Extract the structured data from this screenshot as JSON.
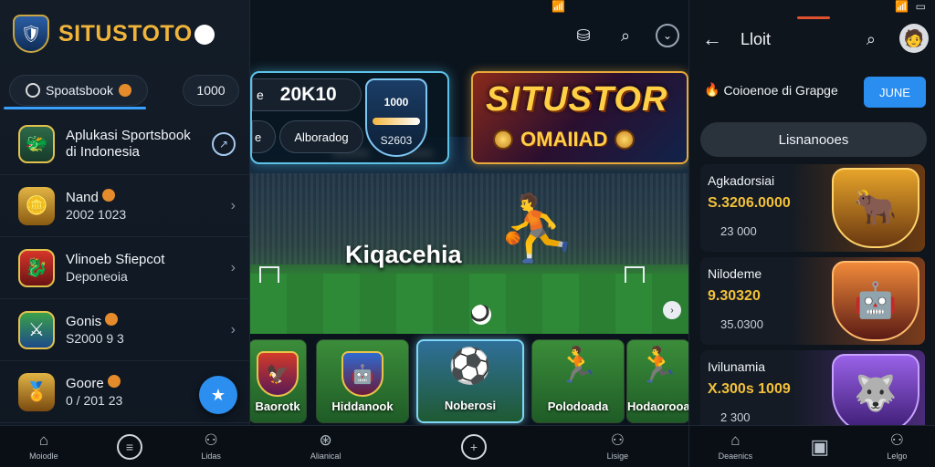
{
  "left": {
    "brand": "SITUSTOTO",
    "tabs": {
      "sportsbook": "Spoatsbook",
      "number": "1000"
    },
    "items": [
      {
        "title": "Aplukasi Sportsbook",
        "sub": "di Indonesia",
        "thumb_icon": "mascot-icon"
      },
      {
        "title": "Nand",
        "sub": "2002 1023",
        "thumb_icon": "coin-stack-icon"
      },
      {
        "title": "Vlinoeb Sfiepcot",
        "sub": "Deponeoia",
        "thumb_icon": "dragon-shield-icon"
      },
      {
        "title": "Gonis",
        "sub": "S2000 9 3",
        "thumb_icon": "green-shield-icon"
      },
      {
        "title": "Goore",
        "sub": "0 / 201 23",
        "thumb_icon": "gold-emblem-icon"
      }
    ],
    "nav": [
      {
        "label": "Moiodle",
        "icon": "home-icon"
      },
      {
        "label": "",
        "icon": "chat-icon"
      },
      {
        "label": "Lidas",
        "icon": "user-icon"
      }
    ]
  },
  "mid": {
    "score": {
      "prefix": "e",
      "value": "20K10",
      "team_short": "e",
      "label2": "Alboradog",
      "shield_top": "1000",
      "shield_bottom": "S2603"
    },
    "promo": {
      "title": "SITUSTOR",
      "sub": "OMAIIAD"
    },
    "hero_title": "Kiqacehia",
    "games": [
      {
        "name": "Baorotk"
      },
      {
        "name": "Hiddanook"
      },
      {
        "name": "Noberosi"
      },
      {
        "name": "Polodoada"
      },
      {
        "name": "Hodaorooa"
      }
    ],
    "nav": [
      {
        "label": "Alianical",
        "icon": "soccer-icon"
      },
      {
        "label": "",
        "icon": "plus-icon"
      },
      {
        "label": "Lisige",
        "icon": "user-icon"
      }
    ]
  },
  "right": {
    "title": "Lloit",
    "coin_text": "Coioenoe di  Grapge",
    "june_button": "JUNE",
    "search_label": "Lisnanooes",
    "cards": [
      {
        "name": "Agkadorsiai",
        "amount": "S.3206.0000",
        "minor": "23 000"
      },
      {
        "name": "Nilodeme",
        "amount": "9.30320",
        "minor": "35.0300"
      },
      {
        "name": "Ivilunamia",
        "amount": "X.300s 1009",
        "minor": "2 300"
      }
    ],
    "nav": [
      {
        "label": "Deaenics",
        "icon": "home-icon"
      },
      {
        "label": "",
        "icon": "box-icon"
      },
      {
        "label": "Lelgo",
        "icon": "user-icon"
      }
    ]
  },
  "colors": {
    "accent": "#2c8ff0",
    "gold": "#f0b43a"
  }
}
